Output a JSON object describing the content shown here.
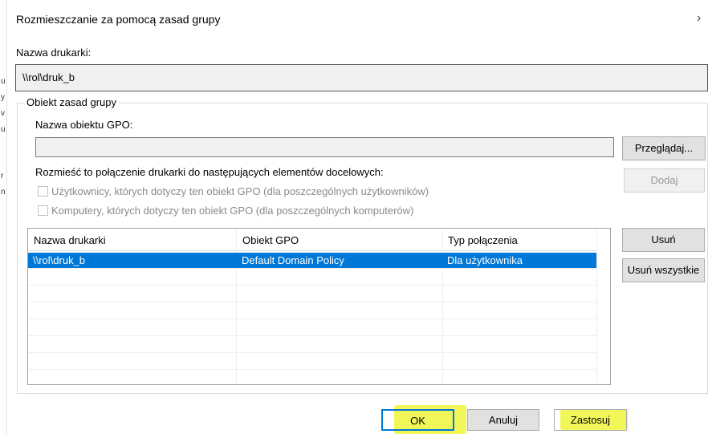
{
  "background_fragments": [
    "u",
    "y",
    "v",
    "u",
    "r",
    "n"
  ],
  "dialog": {
    "title": "Rozmieszczanie za pomocą zasad grupy",
    "close_glyph": "›"
  },
  "printer_name": {
    "label": "Nazwa drukarki:",
    "value": "\\\\rol\\druk_b"
  },
  "group": {
    "legend": "Obiekt zasad grupy",
    "gpo_label": "Nazwa obiektu GPO:",
    "gpo_value": "",
    "browse_button": "Przeglądaj...",
    "deploy_label": "Rozmieść to połączenie drukarki do następujących elementów docelowych:",
    "add_button": "Dodaj",
    "checkbox_users": "Użytkownicy, których dotyczy ten obiekt GPO (dla poszczególnych użytkowników)",
    "checkbox_computers": "Komputery, których dotyczy ten obiekt GPO (dla poszczególnych komputerów)"
  },
  "table": {
    "columns": [
      "Nazwa drukarki",
      "Obiekt GPO",
      "Typ połączenia"
    ],
    "rows": [
      {
        "printer": "\\\\rol\\druk_b",
        "gpo": "Default Domain Policy",
        "type": "Dla użytkownika"
      }
    ]
  },
  "side_buttons": {
    "remove": "Usuń",
    "remove_all": "Usuń wszystkie"
  },
  "footer": {
    "ok": "OK",
    "cancel": "Anuluj",
    "apply": "Zastosuj"
  },
  "colors": {
    "selection": "#0078d7",
    "highlight": "#f0f63c"
  }
}
